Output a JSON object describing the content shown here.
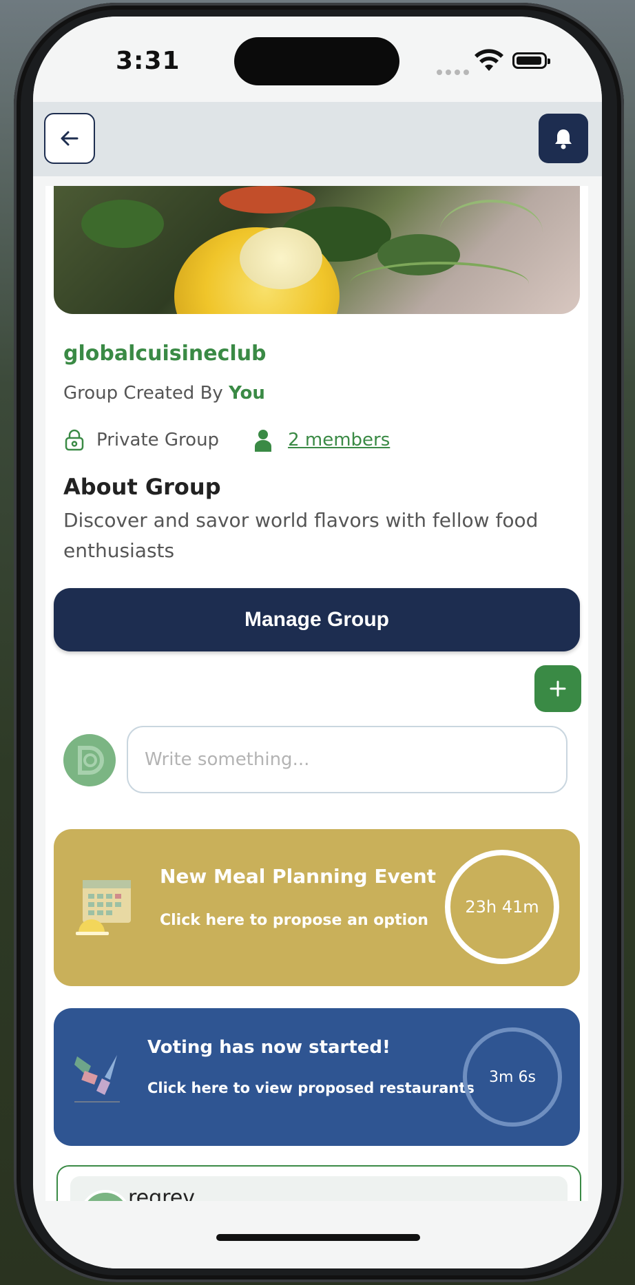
{
  "status_bar": {
    "time": "3:31"
  },
  "group": {
    "name": "globalcuisineclub",
    "created_prefix": "Group Created By",
    "created_by": "You",
    "privacy": "Private Group",
    "members_link": "2 members",
    "about_title": "About Group",
    "about_text": "Discover and savor world flavors with fellow food enthusiasts"
  },
  "actions": {
    "manage_label": "Manage Group"
  },
  "composer": {
    "placeholder": "Write something..."
  },
  "meal_event": {
    "title": "New Meal Planning Event",
    "subtitle": "Click here to propose an option",
    "timer": "23h 41m",
    "color": "#c9b05a"
  },
  "voting": {
    "title": "Voting has now started!",
    "subtitle": "Click here to view proposed restaurants",
    "timer": "3m 6s",
    "color": "#2f5592"
  },
  "post": {
    "username": "regrev",
    "more": "•••"
  },
  "theme": {
    "accent_green": "#3a8a45",
    "navy": "#1d2d50"
  }
}
